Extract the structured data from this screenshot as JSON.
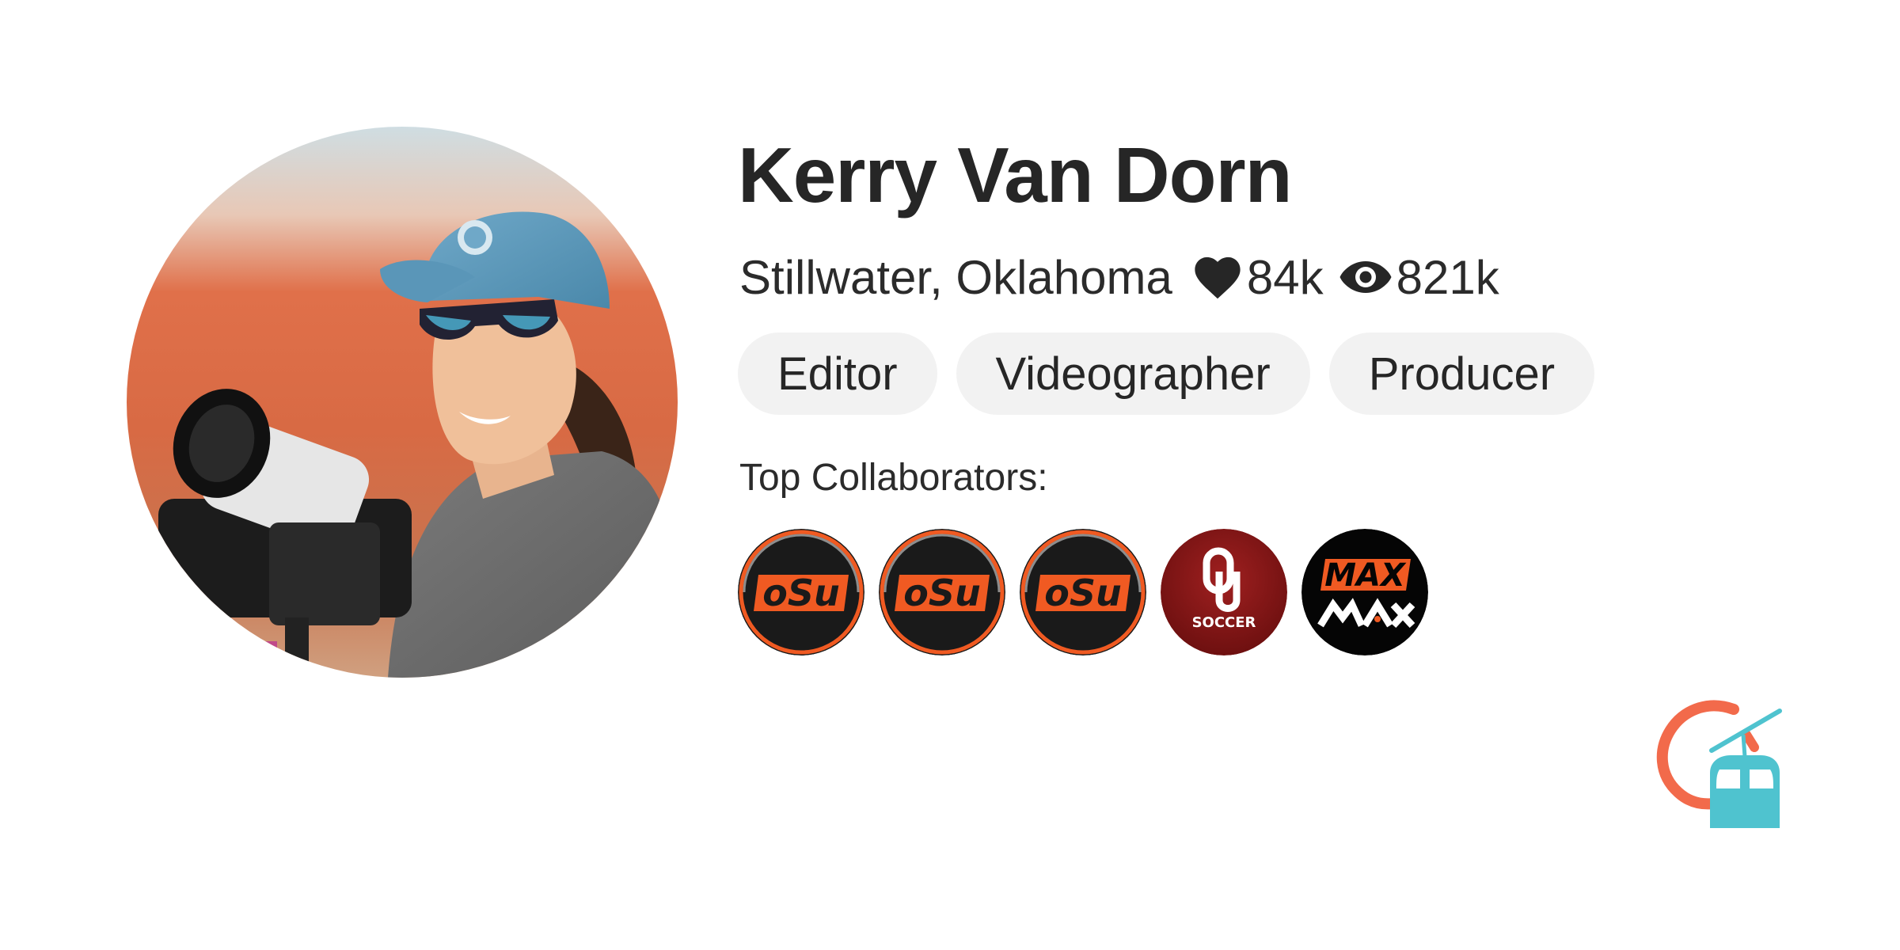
{
  "profile": {
    "name": "Kerry Van Dorn",
    "location": "Stillwater, Oklahoma",
    "likes": "84k",
    "views": "821k",
    "roles": [
      "Editor",
      "Videographer",
      "Producer"
    ],
    "avatar_icon": "profile-photo"
  },
  "collaborators": {
    "label": "Top Collaborators:",
    "items": [
      {
        "logo": "osu-logo",
        "text": "oSu",
        "style": "osu"
      },
      {
        "logo": "osu-logo",
        "text": "oSu",
        "style": "osu"
      },
      {
        "logo": "osu-logo",
        "text": "oSu",
        "style": "osu"
      },
      {
        "logo": "ou-soccer-logo",
        "text": "SOCCER",
        "style": "ou"
      },
      {
        "logo": "osu-max-logo",
        "text": "MAX",
        "style": "osu-max"
      }
    ]
  },
  "icons": {
    "likes": "heart-icon",
    "views": "eye-icon",
    "brand": "gondola-brand-logo"
  },
  "colors": {
    "text": "#262626",
    "tag_bg": "#f2f2f2",
    "osu_orange": "#f05a22",
    "osu_black": "#1a1a1a",
    "ou_crimson": "#8b1a1a",
    "brand_orange": "#f26a4b",
    "brand_teal": "#4fc3cf"
  }
}
